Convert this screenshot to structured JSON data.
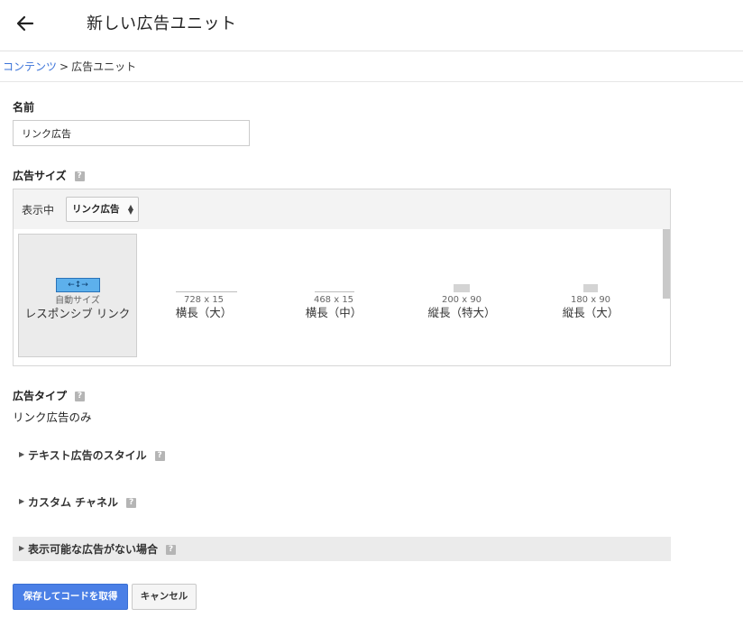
{
  "header": {
    "title": "新しい広告ユニット",
    "back_icon": "arrow-left-icon"
  },
  "breadcrumb": {
    "parent": "コンテンツ",
    "separator": ">",
    "current": "広告ユニット"
  },
  "form": {
    "name_label": "名前",
    "name_value": "リンク広告",
    "ad_size_label": "広告サイズ",
    "showing_label": "表示中",
    "type_select_value": "リンク広告",
    "sizes": [
      {
        "dims": "自動サイズ",
        "name": "レスポンシブ リンク",
        "selected": true
      },
      {
        "dims": "728 x 15",
        "name": "横長（大）",
        "selected": false
      },
      {
        "dims": "468 x 15",
        "name": "横長（中）",
        "selected": false
      },
      {
        "dims": "200 x 90",
        "name": "縦長（特大）",
        "selected": false
      },
      {
        "dims": "180 x 90",
        "name": "縦長（大）",
        "selected": false
      }
    ],
    "ad_type_label": "広告タイプ",
    "ad_type_value": "リンク広告のみ",
    "text_ad_style_label": "テキスト広告のスタイル",
    "custom_channel_label": "カスタム チャネル",
    "no_ads_label": "表示可能な広告がない場合",
    "help_mark": "?"
  },
  "actions": {
    "save_label": "保存してコードを取得",
    "cancel_label": "キャンセル"
  },
  "colors": {
    "accent": "#4a7fe6",
    "link": "#3b73d9",
    "responsive_fill": "#5db0ec"
  }
}
